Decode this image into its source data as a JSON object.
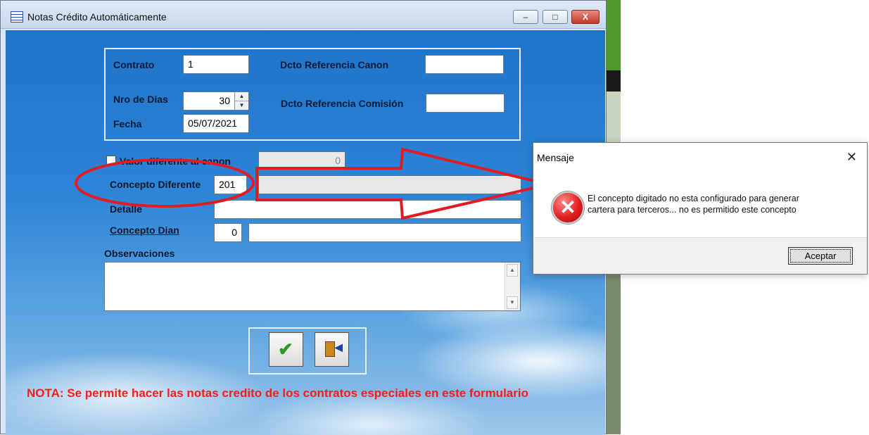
{
  "window": {
    "title": "Notas Crédito Automáticamente",
    "min_glyph": "–",
    "max_glyph": "□",
    "close_glyph": "X"
  },
  "form": {
    "contrato_label": "Contrato",
    "contrato_value": "1",
    "nro_dias_label": "Nro de Dias",
    "nro_dias_value": "30",
    "fecha_label": "Fecha",
    "fecha_value": "05/07/2021",
    "dcto_ref_canon_label": "Dcto Referencia Canon",
    "dcto_ref_canon_value": "",
    "dcto_ref_comision_label": "Dcto Referencia Comisión",
    "dcto_ref_comision_value": "",
    "valor_diferente_label": "Valor diferente al canon",
    "valor_diferente_checked": false,
    "valor_diferente_value": "0",
    "concepto_diferente_label": "Concepto Diferente",
    "concepto_diferente_code": "201",
    "concepto_diferente_desc": "",
    "detalle_label": "Detalle",
    "detalle_value": "",
    "concepto_dian_label": "Concepto Dian",
    "concepto_dian_code": "0",
    "concepto_dian_desc": "",
    "observaciones_label": "Observaciones",
    "observaciones_value": ""
  },
  "toolbar": {
    "accept_icon": "check-icon",
    "exit_icon": "exit-door-icon"
  },
  "nota": "NOTA: Se permite hacer las notas credito de los contratos especiales en este formulario",
  "dialog": {
    "title": "Mensaje",
    "close_glyph": "✕",
    "icon": "error-icon",
    "icon_glyph": "✕",
    "message_line1": "El concepto digitado no esta configurado para generar",
    "message_line2": "cartera para terceros... no es permitido este concepto",
    "ok_label": "Aceptar"
  },
  "colors": {
    "nota_text": "#ff1a1a",
    "annotation_red": "#e01b24",
    "error_icon": "#e1201f"
  }
}
